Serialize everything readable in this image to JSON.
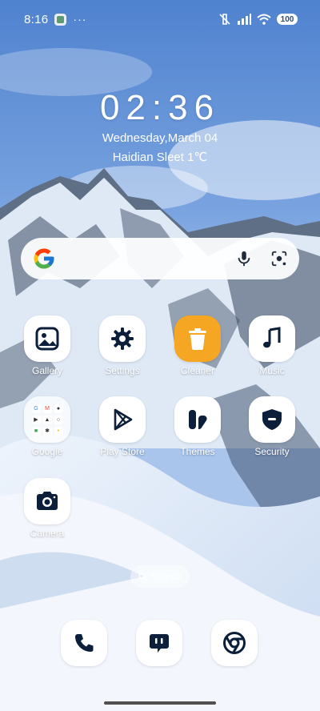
{
  "status_bar": {
    "time": "8:16",
    "overflow": "···",
    "battery": "100",
    "icons": [
      "app-notification-icon",
      "mute-vibrate-icon",
      "signal-icon",
      "wifi-icon",
      "battery-icon"
    ]
  },
  "clock": {
    "time": "02:36",
    "date": "Wednesday,March 04",
    "weather": "Haidian Sleet 1℃"
  },
  "search_bar": {
    "icons": [
      "google-logo-icon",
      "microphone-icon",
      "lens-camera-icon"
    ]
  },
  "apps": [
    {
      "label": "Gallery",
      "icon": "gallery-icon"
    },
    {
      "label": "Settings",
      "icon": "gear-icon"
    },
    {
      "label": "Cleaner",
      "icon": "trash-icon",
      "color": "#f5a623"
    },
    {
      "label": "Music",
      "icon": "music-note-icon"
    },
    {
      "label": "Google",
      "icon": "folder-icon"
    },
    {
      "label": "Play Store",
      "icon": "play-store-icon"
    },
    {
      "label": "Themes",
      "icon": "themes-icon"
    },
    {
      "label": "Security",
      "icon": "shield-icon"
    },
    {
      "label": "Camera",
      "icon": "camera-icon"
    }
  ],
  "folder_minis": [
    "G",
    "M",
    "●",
    "▶",
    "▲",
    "○",
    "■",
    "✱",
    "•"
  ],
  "home_search": {
    "label": "Search"
  },
  "dock": [
    {
      "name": "phone",
      "icon": "phone-icon"
    },
    {
      "name": "messages",
      "icon": "message-icon"
    },
    {
      "name": "chrome",
      "icon": "chrome-icon"
    }
  ],
  "colors": {
    "icon_dark": "#0b1f3a",
    "cleaner_accent": "#f5a623",
    "sky": "#5f8fd6"
  }
}
